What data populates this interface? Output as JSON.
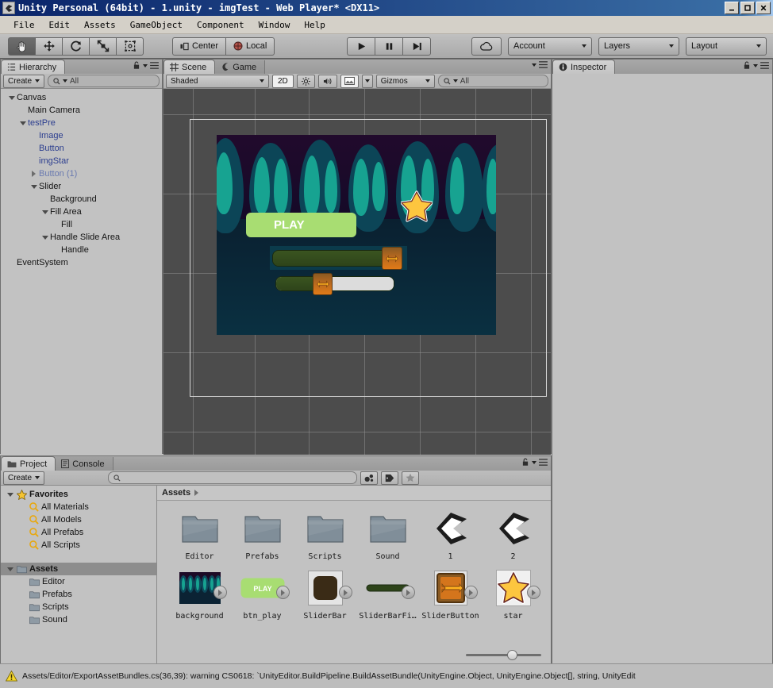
{
  "window": {
    "title": "Unity Personal (64bit) - 1.unity - imgTest - Web Player* <DX11>",
    "icon": "unity-icon",
    "minimize": "_",
    "maximize": "□",
    "close": "X"
  },
  "menubar": {
    "items": [
      "File",
      "Edit",
      "Assets",
      "GameObject",
      "Component",
      "Window",
      "Help"
    ]
  },
  "toolbar": {
    "tools": [
      {
        "name": "hand-tool",
        "active": true
      },
      {
        "name": "move-tool",
        "active": false
      },
      {
        "name": "rotate-tool",
        "active": false
      },
      {
        "name": "scale-tool",
        "active": false
      },
      {
        "name": "rect-tool",
        "active": false
      }
    ],
    "pivot_label": "Center",
    "space_label": "Local",
    "play_label": "play",
    "pause_label": "pause",
    "step_label": "step",
    "cloud_label": "cloud-services",
    "account_label": "Account",
    "layers_label": "Layers",
    "layout_label": "Layout"
  },
  "hierarchy": {
    "tab": "Hierarchy",
    "create_label": "Create",
    "search_value": "All",
    "items": [
      {
        "label": "Canvas",
        "depth": 0,
        "toggle": "open",
        "style": "normal"
      },
      {
        "label": "Main Camera",
        "depth": 1,
        "toggle": "none",
        "style": "normal"
      },
      {
        "label": "testPre",
        "depth": 1,
        "toggle": "open",
        "style": "prefab"
      },
      {
        "label": "Image",
        "depth": 2,
        "toggle": "none",
        "style": "prefab"
      },
      {
        "label": "Button",
        "depth": 2,
        "toggle": "none",
        "style": "prefab"
      },
      {
        "label": "imgStar",
        "depth": 2,
        "toggle": "none",
        "style": "prefab"
      },
      {
        "label": "Button (1)",
        "depth": 2,
        "toggle": "closed",
        "style": "prefab-dim"
      },
      {
        "label": "Slider",
        "depth": 2,
        "toggle": "open",
        "style": "normal"
      },
      {
        "label": "Background",
        "depth": 3,
        "toggle": "none",
        "style": "normal"
      },
      {
        "label": "Fill Area",
        "depth": 3,
        "toggle": "open",
        "style": "normal"
      },
      {
        "label": "Fill",
        "depth": 4,
        "toggle": "none",
        "style": "normal"
      },
      {
        "label": "Handle Slide Area",
        "depth": 3,
        "toggle": "open",
        "style": "normal"
      },
      {
        "label": "Handle",
        "depth": 4,
        "toggle": "none",
        "style": "normal"
      },
      {
        "label": "EventSystem",
        "depth": 0,
        "toggle": "none",
        "style": "normal"
      }
    ]
  },
  "scene": {
    "tabs": [
      {
        "label": "Scene",
        "active": true,
        "icon": "grid-icon"
      },
      {
        "label": "Game",
        "active": false,
        "icon": "gamepad-icon"
      }
    ],
    "draw_mode": "Shaded",
    "mode_2d": "2D",
    "lighting_icon": "sun-icon",
    "audio_icon": "speaker-icon",
    "effects_icon": "image-icon",
    "gizmos_label": "Gizmos",
    "search_value": "All"
  },
  "game_preview": {
    "play_button_label": "PLAY",
    "star_label": "star",
    "slider_top_value": 100,
    "slider_bottom_value": 38,
    "colors": {
      "bg_top": "#210a2c",
      "bg_bottom": "#0a3041",
      "pillar_outer": "#0c4557",
      "pillar_inner": "#17a391",
      "play_button": "#a8dd72",
      "slider_fill": "#34481d",
      "slider_empty": "#dcdcdc",
      "handle": "#e07a18",
      "star_fill": "#fdc63f",
      "star_outline": "#6b2a28"
    }
  },
  "inspector": {
    "tab": "Inspector",
    "icon": "info-icon"
  },
  "project": {
    "tabs": [
      {
        "label": "Project",
        "active": true,
        "icon": "folder-icon"
      },
      {
        "label": "Console",
        "active": false,
        "icon": "console-icon"
      }
    ],
    "create_label": "Create",
    "search_value": "",
    "search_placeholder": "",
    "filter_icons": [
      "type-filter-icon",
      "label-filter-icon",
      "favorite-filter-icon"
    ],
    "breadcrumb": "Assets",
    "tree": [
      {
        "label": "Favorites",
        "depth": 0,
        "toggle": "open",
        "icon": "star-icon",
        "bold": true,
        "selected": false
      },
      {
        "label": "All Materials",
        "depth": 1,
        "toggle": "none",
        "icon": "search-icon",
        "bold": false,
        "selected": false
      },
      {
        "label": "All Models",
        "depth": 1,
        "toggle": "none",
        "icon": "search-icon",
        "bold": false,
        "selected": false
      },
      {
        "label": "All Prefabs",
        "depth": 1,
        "toggle": "none",
        "icon": "search-icon",
        "bold": false,
        "selected": false
      },
      {
        "label": "All Scripts",
        "depth": 1,
        "toggle": "none",
        "icon": "search-icon",
        "bold": false,
        "selected": false
      },
      {
        "label": "",
        "depth": 0,
        "toggle": "none",
        "icon": "spacer",
        "bold": false,
        "selected": false
      },
      {
        "label": "Assets",
        "depth": 0,
        "toggle": "open",
        "icon": "folder-icon",
        "bold": true,
        "selected": true
      },
      {
        "label": "Editor",
        "depth": 1,
        "toggle": "none",
        "icon": "folder-icon",
        "bold": false,
        "selected": false
      },
      {
        "label": "Prefabs",
        "depth": 1,
        "toggle": "none",
        "icon": "folder-icon",
        "bold": false,
        "selected": false
      },
      {
        "label": "Scripts",
        "depth": 1,
        "toggle": "none",
        "icon": "folder-icon",
        "bold": false,
        "selected": false
      },
      {
        "label": "Sound",
        "depth": 1,
        "toggle": "none",
        "icon": "folder-icon",
        "bold": false,
        "selected": false
      }
    ],
    "assets": [
      {
        "name": "Editor",
        "kind": "folder",
        "expandable": false
      },
      {
        "name": "Prefabs",
        "kind": "folder",
        "expandable": false
      },
      {
        "name": "Scripts",
        "kind": "folder",
        "expandable": false
      },
      {
        "name": "Sound",
        "kind": "folder",
        "expandable": false
      },
      {
        "name": "1",
        "kind": "unity-scene",
        "expandable": false
      },
      {
        "name": "2",
        "kind": "unity-scene",
        "expandable": false
      },
      {
        "name": "background",
        "kind": "texture-bg",
        "expandable": true
      },
      {
        "name": "btn_play",
        "kind": "texture-play",
        "expandable": true
      },
      {
        "name": "SliderBar",
        "kind": "texture-bar",
        "expandable": true
      },
      {
        "name": "SliderBarFi…",
        "kind": "texture-fill",
        "expandable": true
      },
      {
        "name": "SliderButton",
        "kind": "texture-btn",
        "expandable": true
      },
      {
        "name": "star",
        "kind": "texture-star",
        "expandable": true
      }
    ],
    "zoom_value": 55
  },
  "statusbar": {
    "icon": "warning-icon",
    "message": "Assets/Editor/ExportAssetBundles.cs(36,39): warning CS0618: `UnityEditor.BuildPipeline.BuildAssetBundle(UnityEngine.Object, UnityEngine.Object[], string, UnityEdit"
  }
}
